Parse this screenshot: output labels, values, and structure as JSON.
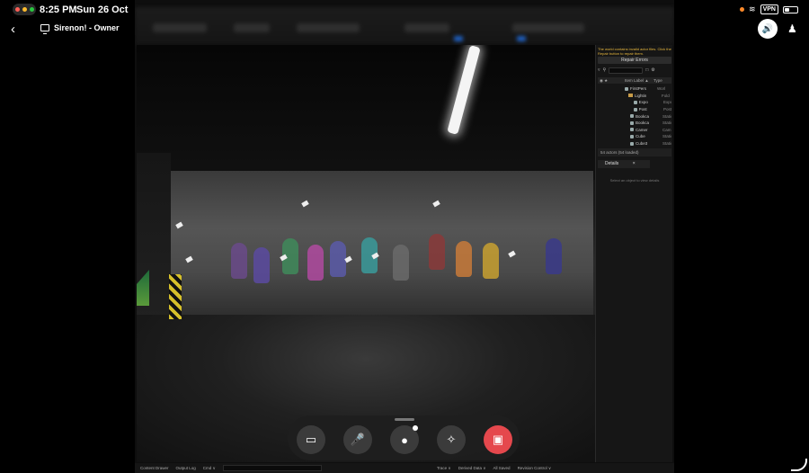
{
  "status_bar": {
    "time": "8:25 PM",
    "date": "Sun 26 Oct",
    "vpn_label": "VPN"
  },
  "session": {
    "title": "Sirenon! - Owner"
  },
  "editor": {
    "outliner": {
      "warning": "The world contains invalid actor files. Click the Repair button to repair them.",
      "repair_button": "Repair Errors",
      "columns": [
        "Item Label ▲",
        "Type"
      ],
      "rows": [
        {
          "name": "FirstPers",
          "type": "Worl"
        },
        {
          "name": "Lightin",
          "type": "Fold"
        },
        {
          "name": "Expo",
          "type": "Expo"
        },
        {
          "name": "Post",
          "type": "Post"
        },
        {
          "name": "Bookca",
          "type": "Static"
        },
        {
          "name": "Bookca",
          "type": "Static"
        },
        {
          "name": "Camer",
          "type": "Cam"
        },
        {
          "name": "Cube",
          "type": "Static"
        },
        {
          "name": "Cube3",
          "type": "Static"
        }
      ],
      "actor_count": "54 actors (54 loaded)"
    },
    "details": {
      "tab_label": "Details",
      "empty_text": "Select an object to view details"
    },
    "bottom_bar": {
      "content_drawer": "Content Drawer",
      "output_log": "Output Log",
      "cmd": "Cmd ∨",
      "trace": "Trace ∨",
      "derived_data": "Derived Data ∨",
      "all_saved": "All Saved",
      "revision_control": "Revision Control ∨"
    }
  },
  "icons": {
    "back": "chevron-left-icon",
    "sound": "speaker-icon",
    "people": "person-add-icon",
    "camera_off": "camera-off-icon",
    "mic": "mic-icon",
    "chat": "chat-bubble-icon",
    "effects": "effects-icon",
    "end_share": "end-screen-share-icon"
  },
  "colors": {
    "end_button": "#e5484d",
    "warning_text": "#e7b73d"
  }
}
